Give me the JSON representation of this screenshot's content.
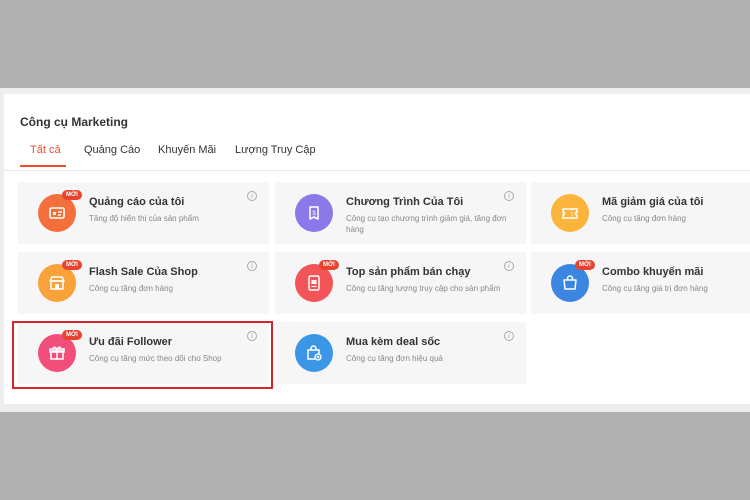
{
  "section_title": "Công cụ Marketing",
  "tabs": [
    {
      "label": "Tất cả",
      "active": true
    },
    {
      "label": "Quảng Cáo"
    },
    {
      "label": "Khuyến Mãi"
    },
    {
      "label": "Lượng Truy Cập"
    }
  ],
  "badge_label": "MỚI",
  "tools": [
    {
      "name": "Quảng cáo của tôi",
      "desc": "Tăng độ hiển thị của sản phẩm",
      "icon": "ads-icon",
      "color": "#f36f3c",
      "new": true
    },
    {
      "name": "Chương Trình Của Tôi",
      "desc": "Công cụ tạo chương trình giảm giá, tăng đơn hàng",
      "icon": "program-icon",
      "color": "#8a79e8",
      "new": false
    },
    {
      "name": "Mã giảm giá của tôi",
      "desc": "Công cụ tăng đơn hàng",
      "icon": "voucher-icon",
      "color": "#fbb53c",
      "new": false
    },
    {
      "name": "Flash Sale Của Shop",
      "desc": "Công cụ tăng đơn hàng",
      "icon": "flash-sale-icon",
      "color": "#f9a23a",
      "new": true
    },
    {
      "name": "Top sản phẩm bán chạy",
      "desc": "Công cụ tăng lượng truy cập cho sản phẩm",
      "icon": "top-products-icon",
      "color": "#f25457",
      "new": true
    },
    {
      "name": "Combo khuyến mãi",
      "desc": "Công cụ tăng giá trị đơn hàng",
      "icon": "combo-icon",
      "color": "#3b86e0",
      "new": true
    },
    {
      "name": "Ưu đãi Follower",
      "desc": "Công cụ tăng mức theo dõi cho Shop",
      "icon": "gift-icon",
      "color": "#f24e7c",
      "new": true
    },
    {
      "name": "Mua kèm deal sốc",
      "desc": "Công cụ tăng đơn hiệu quả",
      "icon": "bag-plus-icon",
      "color": "#3c96e6",
      "new": false
    }
  ],
  "accent_color": "#ee4d2d",
  "highlight_color": "#d9232c"
}
